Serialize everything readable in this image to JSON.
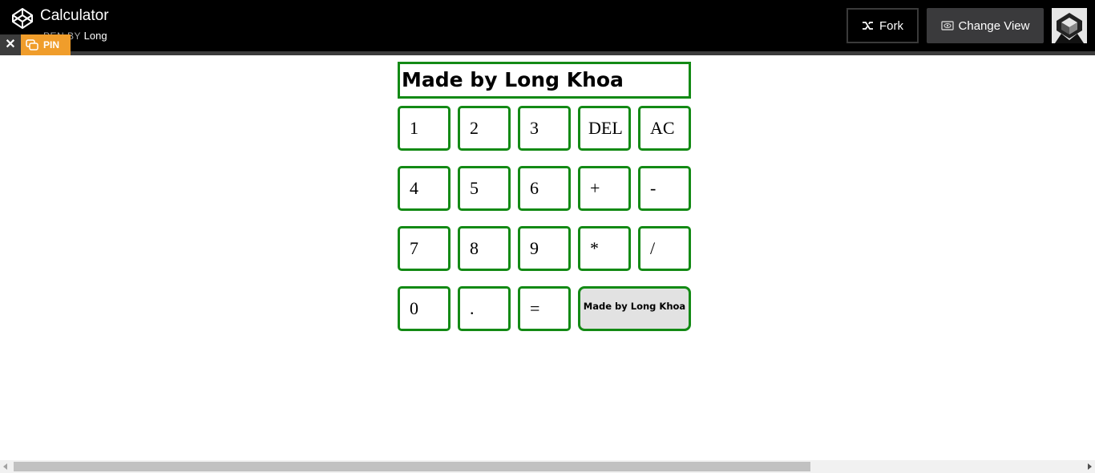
{
  "header": {
    "title": "Calculator",
    "byline_prefix": "PEN BY",
    "author": "Long",
    "close_label": "✕",
    "pin_label": "PIN",
    "fork_label": "Fork",
    "change_view_label": "Change View",
    "logo_icon": "codepen-logo-icon",
    "fork_icon": "fork-icon",
    "view_icon": "eye-icon"
  },
  "calculator": {
    "display": "Made by Long Khoa",
    "keys": [
      "1",
      "2",
      "3",
      "DEL",
      "AC",
      "4",
      "5",
      "6",
      "+",
      "-",
      "7",
      "8",
      "9",
      "*",
      "/",
      "0",
      ".",
      "="
    ],
    "credit_label": "Made by Long Khoa"
  },
  "colors": {
    "key_border": "#138a15",
    "pin_bg": "#f09d2b",
    "header_bg": "#000000"
  }
}
